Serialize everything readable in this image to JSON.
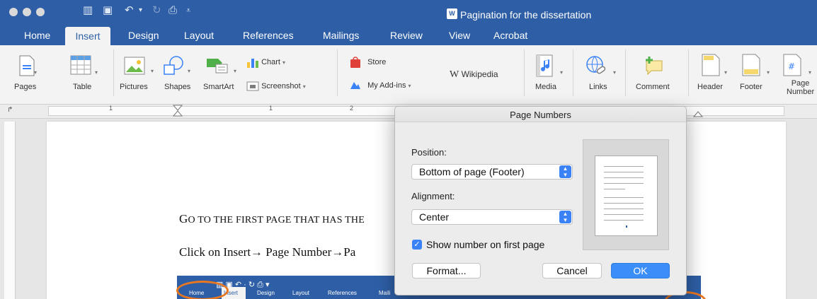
{
  "app": {
    "doc_title": "Pagination for the dissertation",
    "doc_badge": "W"
  },
  "tabs": [
    "Home",
    "Insert",
    "Design",
    "Layout",
    "References",
    "Mailings",
    "Review",
    "View",
    "Acrobat"
  ],
  "active_tab": "Insert",
  "ribbon": {
    "pages": "Pages",
    "table": "Table",
    "pictures": "Pictures",
    "shapes": "Shapes",
    "smartart": "SmartArt",
    "chart": "Chart",
    "screenshot": "Screenshot",
    "store": "Store",
    "my_addins": "My Add-ins",
    "wikipedia": "Wikipedia",
    "media": "Media",
    "links": "Links",
    "comment": "Comment",
    "header": "Header",
    "footer": "Footer",
    "page_number_1": "Page",
    "page_number_2": "Number"
  },
  "ruler": {
    "n1": "1",
    "n2": "1",
    "n3": "2"
  },
  "document": {
    "line1_cap": "G",
    "line1_rest": "O TO THE FIRST PAGE THAT HAS THE",
    "line2": "Click on  Insert→ Page Number→Pa",
    "embed_tabs": [
      "Home",
      "Insert",
      "Design",
      "Layout",
      "References",
      "Maili"
    ]
  },
  "dialog": {
    "title": "Page Numbers",
    "position_label": "Position:",
    "position_value": "Bottom of page (Footer)",
    "alignment_label": "Alignment:",
    "alignment_value": "Center",
    "show_first_page": "Show number on first page",
    "show_first_page_checked": true,
    "format_button": "Format...",
    "cancel_button": "Cancel",
    "ok_button": "OK"
  },
  "colors": {
    "accent": "#2e5fa6",
    "button_blue": "#3b8ef7",
    "highlight_ring": "#e87722"
  }
}
